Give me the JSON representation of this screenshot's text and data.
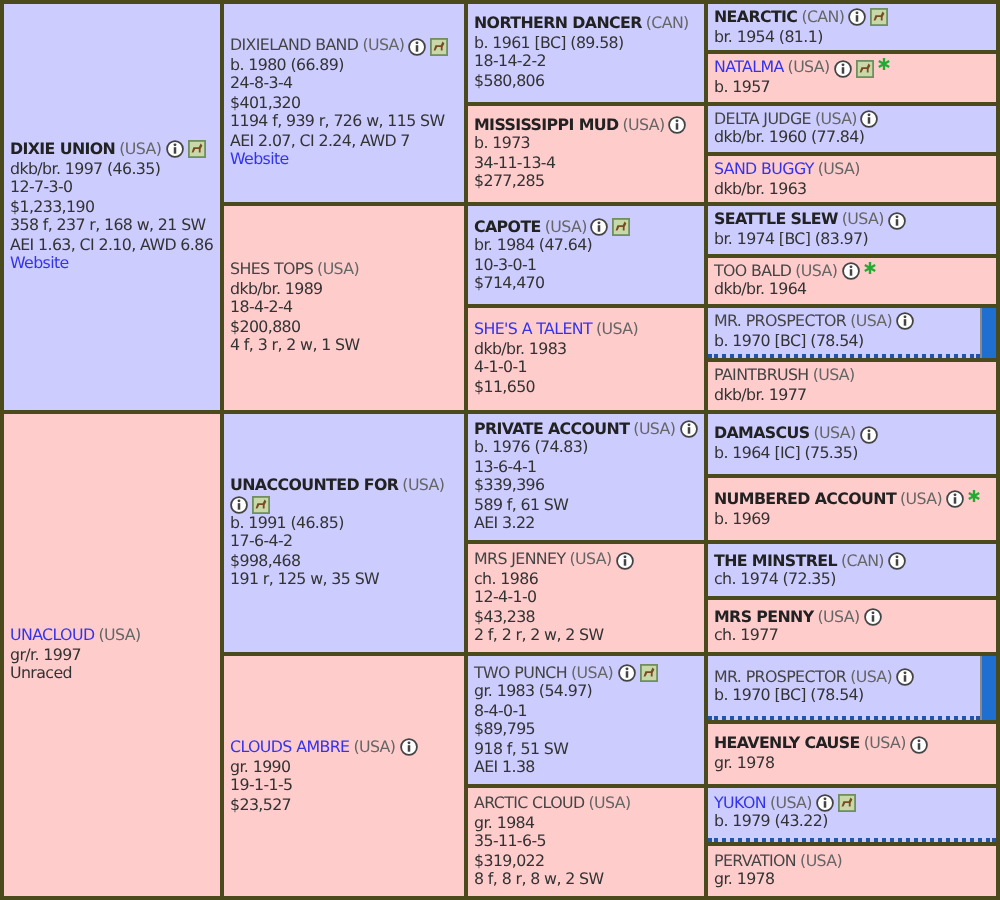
{
  "pedigree": [
    {
      "kind": "male",
      "name": {
        "text": "DIXIE UNION",
        "kind": "bold"
      },
      "country": "(USA)",
      "icons": [
        {
          "kind": "info"
        },
        {
          "kind": "photo"
        }
      ],
      "dotted": false,
      "side_tab": false,
      "lines": [
        "dkb/br. 1997 (46.35)",
        "12-7-3-0",
        "$1,233,190",
        "358 f, 237 r, 168 w, 21 SW",
        "AEI 1.63, CI 2.10, AWD 6.86"
      ],
      "website": "Website",
      "children": [
        {
          "kind": "male",
          "name": {
            "text": "DIXIELAND BAND",
            "kind": "plain"
          },
          "country": "(USA)",
          "icons": [
            {
              "kind": "info"
            },
            {
              "kind": "photo"
            }
          ],
          "dotted": false,
          "side_tab": false,
          "lines": [
            "b. 1980 (66.89)",
            "24-8-3-4",
            "$401,320",
            "1194 f, 939 r, 726 w, 115 SW",
            "AEI 2.07, CI 2.24, AWD 7"
          ],
          "website": "Website",
          "children": [
            {
              "kind": "male",
              "name": {
                "text": "NORTHERN DANCER",
                "kind": "bold"
              },
              "country": "(CAN)",
              "dotted": false,
              "side_tab": false,
              "lines": [
                "b. 1961 [BC] (89.58)",
                "18-14-2-2",
                "$580,806"
              ],
              "children": [
                {
                  "kind": "male",
                  "name": {
                    "text": "NEARCTIC",
                    "kind": "bold"
                  },
                  "country": "(CAN)",
                  "icons": [
                    {
                      "kind": "info"
                    },
                    {
                      "kind": "photo"
                    }
                  ],
                  "dotted": false,
                  "side_tab": false,
                  "lines": [
                    "br. 1954 (81.1)"
                  ]
                },
                {
                  "kind": "female",
                  "name": {
                    "text": "NATALMA",
                    "kind": "link"
                  },
                  "country": "(USA)",
                  "icons": [
                    {
                      "kind": "info"
                    },
                    {
                      "kind": "photo"
                    },
                    {
                      "kind": "star"
                    }
                  ],
                  "dotted": false,
                  "side_tab": false,
                  "lines": [
                    "b. 1957"
                  ]
                }
              ]
            },
            {
              "kind": "female",
              "name": {
                "text": "MISSISSIPPI MUD",
                "kind": "bold"
              },
              "country": "(USA)",
              "icons": [
                {
                  "kind": "info"
                }
              ],
              "dotted": false,
              "side_tab": false,
              "lines": [
                "b. 1973",
                "34-11-13-4",
                "$277,285"
              ],
              "children": [
                {
                  "kind": "male",
                  "name": {
                    "text": "DELTA JUDGE",
                    "kind": "plain"
                  },
                  "country": "(USA)",
                  "icons": [
                    {
                      "kind": "info"
                    }
                  ],
                  "dotted": false,
                  "side_tab": false,
                  "lines": [
                    "dkb/br. 1960 (77.84)"
                  ]
                },
                {
                  "kind": "female",
                  "name": {
                    "text": "SAND BUGGY",
                    "kind": "link"
                  },
                  "country": "(USA)",
                  "dotted": false,
                  "side_tab": false,
                  "lines": [
                    "dkb/br. 1963"
                  ]
                }
              ]
            }
          ]
        },
        {
          "kind": "female",
          "name": {
            "text": "SHES TOPS",
            "kind": "plain"
          },
          "country": "(USA)",
          "dotted": false,
          "side_tab": false,
          "lines": [
            "dkb/br. 1989",
            "18-4-2-4",
            "$200,880",
            "4 f, 3 r, 2 w, 1 SW"
          ],
          "children": [
            {
              "kind": "male",
              "name": {
                "text": "CAPOTE",
                "kind": "bold"
              },
              "country": "(USA)",
              "icons": [
                {
                  "kind": "info"
                },
                {
                  "kind": "photo"
                }
              ],
              "dotted": false,
              "side_tab": false,
              "lines": [
                "br. 1984 (47.64)",
                "10-3-0-1",
                "$714,470"
              ],
              "children": [
                {
                  "kind": "male",
                  "name": {
                    "text": "SEATTLE SLEW",
                    "kind": "bold"
                  },
                  "country": "(USA)",
                  "icons": [
                    {
                      "kind": "info"
                    }
                  ],
                  "dotted": false,
                  "side_tab": false,
                  "lines": [
                    "br. 1974 [BC] (83.97)"
                  ]
                },
                {
                  "kind": "female",
                  "name": {
                    "text": "TOO BALD",
                    "kind": "plain"
                  },
                  "country": "(USA)",
                  "icons": [
                    {
                      "kind": "info"
                    },
                    {
                      "kind": "star"
                    }
                  ],
                  "dotted": false,
                  "side_tab": false,
                  "lines": [
                    "dkb/br. 1964"
                  ]
                }
              ]
            },
            {
              "kind": "female",
              "name": {
                "text": "SHE'S A TALENT",
                "kind": "link"
              },
              "country": "(USA)",
              "dotted": false,
              "side_tab": false,
              "lines": [
                "dkb/br. 1983",
                "4-1-0-1",
                "$11,650"
              ],
              "children": [
                {
                  "kind": "male",
                  "name": {
                    "text": "MR. PROSPECTOR",
                    "kind": "plain"
                  },
                  "country": "(USA)",
                  "icons": [
                    {
                      "kind": "info"
                    }
                  ],
                  "dotted": true,
                  "side_tab": true,
                  "lines": [
                    "b. 1970 [BC] (78.54)"
                  ]
                },
                {
                  "kind": "female",
                  "name": {
                    "text": "PAINTBRUSH",
                    "kind": "plain"
                  },
                  "country": "(USA)",
                  "dotted": false,
                  "side_tab": false,
                  "lines": [
                    "dkb/br. 1977"
                  ]
                }
              ]
            }
          ]
        }
      ]
    },
    {
      "kind": "female",
      "name": {
        "text": "UNACLOUD",
        "kind": "link"
      },
      "country": "(USA)",
      "dotted": false,
      "side_tab": false,
      "lines": [
        "gr/r. 1997",
        "Unraced"
      ],
      "children": [
        {
          "kind": "male",
          "name": {
            "text": "UNACCOUNTED FOR",
            "kind": "bold"
          },
          "country": "(USA)",
          "icons": [
            {
              "kind": "info"
            },
            {
              "kind": "photo"
            }
          ],
          "dotted": false,
          "side_tab": false,
          "lines": [
            "b. 1991 (46.85)",
            "17-6-4-2",
            "$998,468",
            "191 r, 125 w, 35 SW"
          ],
          "children": [
            {
              "kind": "male",
              "name": {
                "text": "PRIVATE ACCOUNT",
                "kind": "bold"
              },
              "country": "(USA)",
              "icons": [
                {
                  "kind": "info"
                }
              ],
              "dotted": false,
              "side_tab": false,
              "lines": [
                "b. 1976 (74.83)",
                "13-6-4-1",
                "$339,396",
                "589 f, 61 SW",
                "AEI 3.22"
              ],
              "children": [
                {
                  "kind": "male",
                  "name": {
                    "text": "DAMASCUS",
                    "kind": "bold"
                  },
                  "country": "(USA)",
                  "icons": [
                    {
                      "kind": "info"
                    }
                  ],
                  "dotted": false,
                  "side_tab": false,
                  "lines": [
                    "b. 1964 [IC] (75.35)"
                  ]
                },
                {
                  "kind": "female",
                  "name": {
                    "text": "NUMBERED ACCOUNT",
                    "kind": "bold"
                  },
                  "country": "(USA)",
                  "icons": [
                    {
                      "kind": "info"
                    },
                    {
                      "kind": "star"
                    }
                  ],
                  "dotted": false,
                  "side_tab": false,
                  "lines": [
                    "b. 1969"
                  ]
                }
              ]
            },
            {
              "kind": "female",
              "name": {
                "text": "MRS JENNEY",
                "kind": "plain"
              },
              "country": "(USA)",
              "icons": [
                {
                  "kind": "info"
                }
              ],
              "dotted": false,
              "side_tab": false,
              "lines": [
                "ch. 1986",
                "12-4-1-0",
                "$43,238",
                "2 f, 2 r, 2 w, 2 SW"
              ],
              "children": [
                {
                  "kind": "male",
                  "name": {
                    "text": "THE MINSTREL",
                    "kind": "bold"
                  },
                  "country": "(CAN)",
                  "icons": [
                    {
                      "kind": "info"
                    }
                  ],
                  "dotted": false,
                  "side_tab": false,
                  "lines": [
                    "ch. 1974 (72.35)"
                  ]
                },
                {
                  "kind": "female",
                  "name": {
                    "text": "MRS PENNY",
                    "kind": "bold"
                  },
                  "country": "(USA)",
                  "icons": [
                    {
                      "kind": "info"
                    }
                  ],
                  "dotted": false,
                  "side_tab": false,
                  "lines": [
                    "ch. 1977"
                  ]
                }
              ]
            }
          ]
        },
        {
          "kind": "female",
          "name": {
            "text": "CLOUDS AMBRE",
            "kind": "link"
          },
          "country": "(USA)",
          "icons": [
            {
              "kind": "info"
            }
          ],
          "dotted": false,
          "side_tab": false,
          "lines": [
            "gr. 1990",
            "19-1-1-5",
            "$23,527"
          ],
          "children": [
            {
              "kind": "male",
              "name": {
                "text": "TWO PUNCH",
                "kind": "plain"
              },
              "country": "(USA)",
              "icons": [
                {
                  "kind": "info"
                },
                {
                  "kind": "photo"
                }
              ],
              "dotted": false,
              "side_tab": false,
              "lines": [
                "gr. 1983 (54.97)",
                "8-4-0-1",
                "$89,795",
                "918 f, 51 SW",
                "AEI 1.38"
              ],
              "children": [
                {
                  "kind": "male",
                  "name": {
                    "text": "MR. PROSPECTOR",
                    "kind": "plain"
                  },
                  "country": "(USA)",
                  "icons": [
                    {
                      "kind": "info"
                    }
                  ],
                  "dotted": true,
                  "side_tab": true,
                  "lines": [
                    "b. 1970 [BC] (78.54)"
                  ]
                },
                {
                  "kind": "female",
                  "name": {
                    "text": "HEAVENLY CAUSE",
                    "kind": "bold"
                  },
                  "country": "(USA)",
                  "icons": [
                    {
                      "kind": "info"
                    }
                  ],
                  "dotted": false,
                  "side_tab": false,
                  "lines": [
                    "gr. 1978"
                  ]
                }
              ]
            },
            {
              "kind": "female",
              "name": {
                "text": "ARCTIC CLOUD",
                "kind": "plain"
              },
              "country": "(USA)",
              "dotted": false,
              "side_tab": false,
              "lines": [
                "gr. 1984",
                "35-11-6-5",
                "$319,022",
                "8 f, 8 r, 8 w, 2 SW"
              ],
              "children": [
                {
                  "kind": "male",
                  "name": {
                    "text": "YUKON",
                    "kind": "link"
                  },
                  "country": "(USA)",
                  "icons": [
                    {
                      "kind": "info"
                    },
                    {
                      "kind": "photo"
                    }
                  ],
                  "dotted": true,
                  "side_tab": false,
                  "lines": [
                    "b. 1979 (43.22)"
                  ]
                },
                {
                  "kind": "female",
                  "name": {
                    "text": "PERVATION",
                    "kind": "plain"
                  },
                  "country": "(USA)",
                  "dotted": false,
                  "side_tab": false,
                  "lines": [
                    "gr. 1978"
                  ]
                }
              ]
            }
          ]
        }
      ]
    }
  ]
}
